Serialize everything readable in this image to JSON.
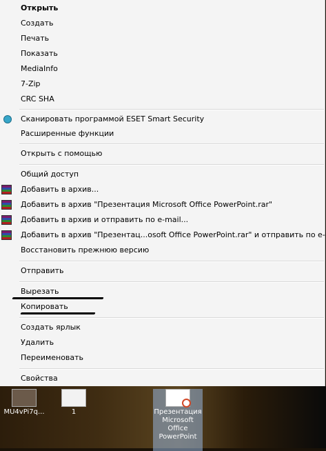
{
  "menu": {
    "items": [
      {
        "label": "Открыть"
      },
      {
        "label": "Создать"
      },
      {
        "label": "Печать"
      },
      {
        "label": "Показать"
      },
      {
        "label": "MediaInfo"
      },
      {
        "label": "7-Zip"
      },
      {
        "label": "CRC SHA"
      },
      {
        "label": "Сканировать программой ESET Smart Security"
      },
      {
        "label": "Расширенные функции"
      },
      {
        "label": "Открыть с помощью"
      },
      {
        "label": "Общий доступ"
      },
      {
        "label": "Добавить в архив..."
      },
      {
        "label": "Добавить в архив \"Презентация Microsoft Office PowerPoint.rar\""
      },
      {
        "label": "Добавить в архив и отправить по e-mail..."
      },
      {
        "label": "Добавить в архив \"Презентац...osoft Office PowerPoint.rar\" и отправить по e-mail"
      },
      {
        "label": "Восстановить прежнюю версию"
      },
      {
        "label": "Отправить"
      },
      {
        "label": "Вырезать"
      },
      {
        "label": "Копировать"
      },
      {
        "label": "Создать ярлык"
      },
      {
        "label": "Удалить"
      },
      {
        "label": "Переименовать"
      },
      {
        "label": "Свойства"
      }
    ]
  },
  "desktop": {
    "icons": [
      {
        "label": "MU4vPi7q..."
      },
      {
        "label": "1"
      },
      {
        "label": "Презентация Microsoft Office PowerPoint"
      }
    ]
  }
}
